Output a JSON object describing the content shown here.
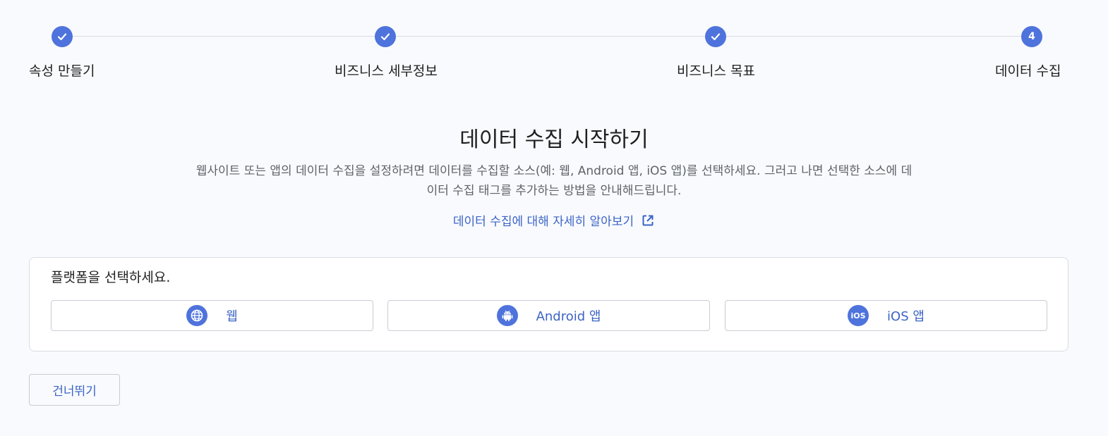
{
  "stepper": {
    "steps": [
      {
        "label": "속성 만들기",
        "state": "done"
      },
      {
        "label": "비즈니스 세부정보",
        "state": "done"
      },
      {
        "label": "비즈니스 목표",
        "state": "done"
      },
      {
        "label": "데이터 수집",
        "state": "current",
        "number": "4"
      }
    ]
  },
  "main": {
    "title": "데이터 수집 시작하기",
    "description": "웹사이트 또는 앱의 데이터 수집을 설정하려면 데이터를 수집할 소스(예: 웹, Android 앱, iOS 앱)를 선택하세요. 그러고 나면 선택한 소스에 데이터 수집 태그를 추가하는 방법을 안내해드립니다.",
    "learn_link": "데이터 수집에 대해 자세히 알아보기"
  },
  "platform": {
    "title": "플랫폼을 선택하세요.",
    "options": [
      {
        "label": "웹",
        "icon": "globe-icon"
      },
      {
        "label": "Android 앱",
        "icon": "android-icon"
      },
      {
        "label": "iOS 앱",
        "icon": "ios-icon",
        "icon_text": "iOS"
      }
    ]
  },
  "skip_button": "건너뛰기",
  "colors": {
    "accent": "#4f73dc",
    "link": "#3c64c6",
    "background": "#f8fafd"
  }
}
